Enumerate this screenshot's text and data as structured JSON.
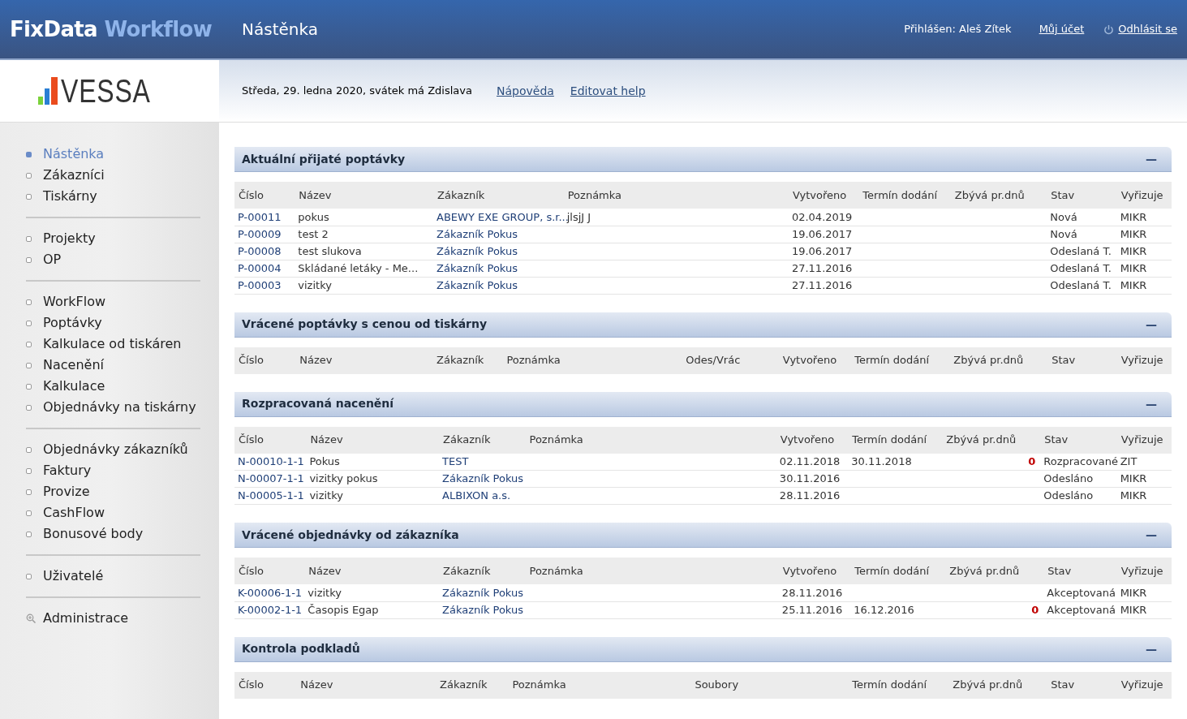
{
  "header": {
    "brand_first": "FixData",
    "brand_second": "Workflow",
    "page_title": "Nástěnka",
    "logged_in": "Přihlášen: Aleš Zítek",
    "account_link": "Můj účet",
    "logout_link": "Odhlásit se"
  },
  "logo": {
    "text": "VESSA"
  },
  "infobar": {
    "date": "Středa, 29. ledna 2020, svátek má Zdislava",
    "links": [
      "Nápověda",
      "Editovat help"
    ]
  },
  "sidebar": {
    "groups": [
      [
        {
          "label": "Nástěnka",
          "selected": true,
          "kind": "bullet"
        },
        {
          "label": "Zákazníci",
          "selected": false,
          "kind": "bullet"
        },
        {
          "label": "Tiskárny",
          "selected": false,
          "kind": "bullet"
        }
      ],
      [
        {
          "label": "Projekty",
          "selected": false,
          "kind": "bullet"
        },
        {
          "label": "OP",
          "selected": false,
          "kind": "bullet"
        }
      ],
      [
        {
          "label": "WorkFlow",
          "selected": false,
          "kind": "bullet"
        },
        {
          "label": "Poptávky",
          "selected": false,
          "kind": "bullet"
        },
        {
          "label": "Kalkulace od tiskáren",
          "selected": false,
          "kind": "bullet"
        },
        {
          "label": "Nacenění",
          "selected": false,
          "kind": "bullet"
        },
        {
          "label": "Kalkulace",
          "selected": false,
          "kind": "bullet"
        },
        {
          "label": "Objednávky na tiskárny",
          "selected": false,
          "kind": "bullet"
        }
      ],
      [
        {
          "label": "Objednávky zákazníků",
          "selected": false,
          "kind": "bullet"
        },
        {
          "label": "Faktury",
          "selected": false,
          "kind": "bullet"
        },
        {
          "label": "Provize",
          "selected": false,
          "kind": "bullet"
        },
        {
          "label": "CashFlow",
          "selected": false,
          "kind": "bullet"
        },
        {
          "label": "Bonusové body",
          "selected": false,
          "kind": "bullet"
        }
      ],
      [
        {
          "label": "Uživatelé",
          "selected": false,
          "kind": "bullet"
        }
      ],
      [
        {
          "label": "Administrace",
          "selected": false,
          "kind": "zoom"
        }
      ]
    ]
  },
  "sections": [
    {
      "title": "Aktuální přijaté poptávky",
      "collapse": "—",
      "columns": [
        {
          "label": "Číslo",
          "kind": "link"
        },
        {
          "label": "Název",
          "kind": "text"
        },
        {
          "label": "Zákazník",
          "kind": "link"
        },
        {
          "label": "Poznámka",
          "kind": "text"
        },
        {
          "label": "Vytvořeno",
          "kind": "text"
        },
        {
          "label": "Termín dodání",
          "kind": "text"
        },
        {
          "label": "Zbývá pr.dnů",
          "kind": "alert"
        },
        {
          "label": "Stav",
          "kind": "text"
        },
        {
          "label": "Vyřizuje",
          "kind": "text"
        }
      ],
      "rows": [
        [
          "P-00011",
          "pokus",
          "ABEWY EXE GROUP, s.r...",
          "jlsjJ J",
          "02.04.2019",
          "",
          "",
          "Nová",
          "MIKR"
        ],
        [
          "P-00009",
          "test 2",
          "Zákazník Pokus",
          "",
          "19.06.2017",
          "",
          "",
          "Nová",
          "MIKR"
        ],
        [
          "P-00008",
          "test slukova",
          "Zákazník Pokus",
          "",
          "19.06.2017",
          "",
          "",
          "Odeslaná T.",
          "MIKR"
        ],
        [
          "P-00004",
          "Skládané letáky - Me...",
          "Zákazník Pokus",
          "",
          "27.11.2016",
          "",
          "",
          "Odeslaná T.",
          "MIKR"
        ],
        [
          "P-00003",
          "vizitky",
          "Zákazník Pokus",
          "",
          "27.11.2016",
          "",
          "",
          "Odeslaná T.",
          "MIKR"
        ]
      ]
    },
    {
      "title": "Vrácené poptávky s cenou od tiskárny",
      "collapse": "—",
      "columns": [
        {
          "label": "Číslo",
          "kind": "link"
        },
        {
          "label": "Název",
          "kind": "text"
        },
        {
          "label": "Zákazník",
          "kind": "link"
        },
        {
          "label": "Poznámka",
          "kind": "text"
        },
        {
          "label": "Odes/Vrác",
          "kind": "text"
        },
        {
          "label": "Vytvořeno",
          "kind": "text"
        },
        {
          "label": "Termín dodání",
          "kind": "text"
        },
        {
          "label": "Zbývá pr.dnů",
          "kind": "alert"
        },
        {
          "label": "Stav",
          "kind": "text"
        },
        {
          "label": "Vyřizuje",
          "kind": "text"
        }
      ]
    },
    {
      "title": "Rozpracovaná nacenění",
      "collapse": "—",
      "columns": [
        {
          "label": "Číslo",
          "kind": "link"
        },
        {
          "label": "Název",
          "kind": "text"
        },
        {
          "label": "Zákazník",
          "kind": "link"
        },
        {
          "label": "Poznámka",
          "kind": "text"
        },
        {
          "label": "Vytvořeno",
          "kind": "text"
        },
        {
          "label": "Termín dodání",
          "kind": "text"
        },
        {
          "label": "Zbývá pr.dnů",
          "kind": "alert"
        },
        {
          "label": "Stav",
          "kind": "text"
        },
        {
          "label": "Vyřizuje",
          "kind": "text"
        }
      ],
      "rows": [
        [
          "N-00010-1-1",
          "Pokus",
          "TEST",
          "",
          "02.11.2018",
          "30.11.2018",
          "0",
          "Rozpracované",
          "ZIT"
        ],
        [
          "N-00007-1-1",
          "vizitky pokus",
          "Zákazník Pokus",
          "",
          "30.11.2016",
          "",
          "",
          "Odesláno",
          "MIKR"
        ],
        [
          "N-00005-1-1",
          "vizitky",
          "ALBIXON a.s.",
          "",
          "28.11.2016",
          "",
          "",
          "Odesláno",
          "MIKR"
        ]
      ]
    },
    {
      "title": "Vrácené objednávky od zákazníka",
      "collapse": "—",
      "columns": [
        {
          "label": "Číslo",
          "kind": "link"
        },
        {
          "label": "Název",
          "kind": "text"
        },
        {
          "label": "Zákazník",
          "kind": "link"
        },
        {
          "label": "Poznámka",
          "kind": "text"
        },
        {
          "label": "Vytvořeno",
          "kind": "text"
        },
        {
          "label": "Termín dodání",
          "kind": "text"
        },
        {
          "label": "Zbývá pr.dnů",
          "kind": "alert"
        },
        {
          "label": "Stav",
          "kind": "text"
        },
        {
          "label": "Vyřizuje",
          "kind": "text"
        }
      ],
      "rows": [
        [
          "K-00006-1-1",
          "vizitky",
          "Zákazník Pokus",
          "",
          "28.11.2016",
          "",
          "",
          "Akceptovaná",
          "MIKR"
        ],
        [
          "K-00002-1-1",
          "Časopis Egap",
          "Zákazník Pokus",
          "",
          "25.11.2016",
          "16.12.2016",
          "0",
          "Akceptovaná",
          "MIKR"
        ]
      ]
    },
    {
      "title": "Kontrola podkladů",
      "collapse": "—",
      "columns": [
        {
          "label": "Číslo",
          "kind": "link"
        },
        {
          "label": "Název",
          "kind": "text"
        },
        {
          "label": "Zákazník",
          "kind": "link"
        },
        {
          "label": "Poznámka",
          "kind": "text"
        },
        {
          "label": "Soubory",
          "kind": "text"
        },
        {
          "label": "Termín dodání",
          "kind": "text"
        },
        {
          "label": "Zbývá pr.dnů",
          "kind": "alert"
        },
        {
          "label": "Stav",
          "kind": "text"
        },
        {
          "label": "Vyřizuje",
          "kind": "text"
        }
      ]
    }
  ]
}
